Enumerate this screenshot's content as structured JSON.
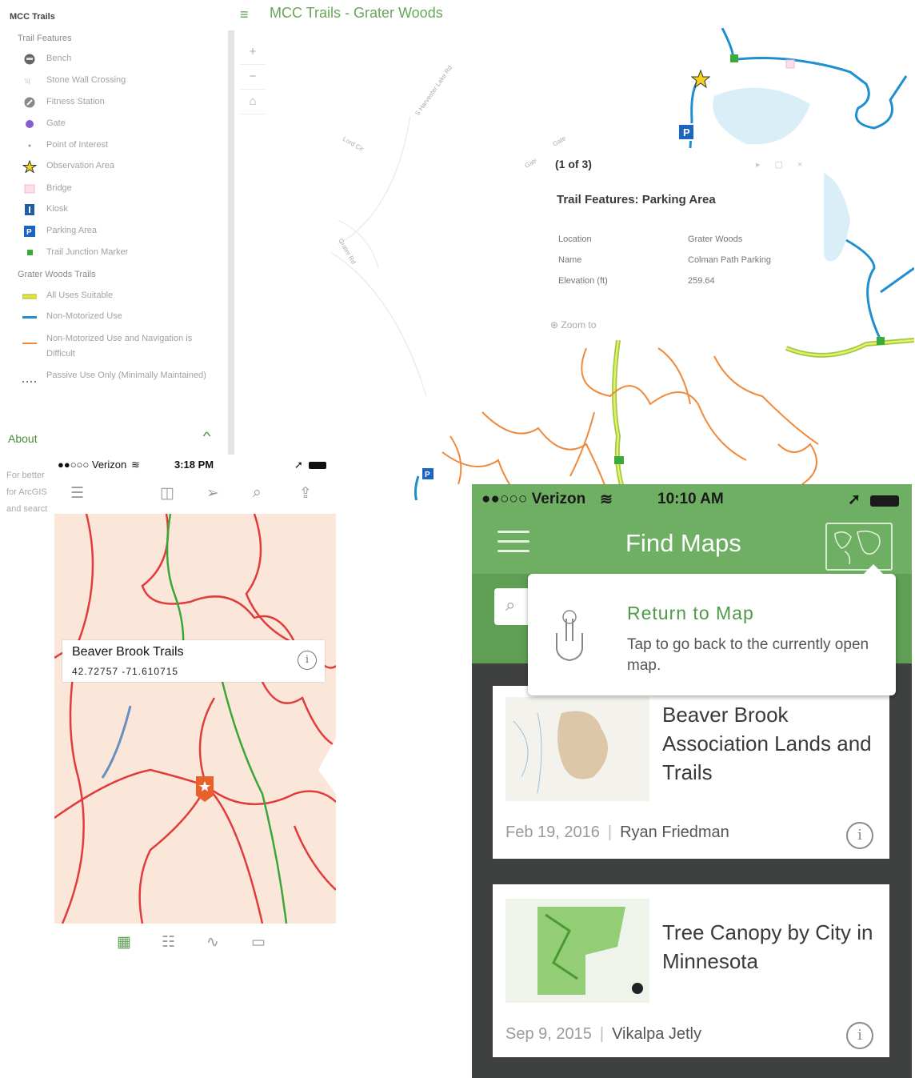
{
  "webapp": {
    "sidebar_title": "MCC Trails",
    "header_title": "MCC Trails - Grater Woods",
    "legend": {
      "trail_features_heading": "Trail Features",
      "trail_features": [
        "Bench",
        "Stone Wall Crossing",
        "Fitness Station",
        "Gate",
        "Point of Interest",
        "Observation Area",
        "Bridge",
        "Kiosk",
        "Parking Area",
        "Trail Junction Marker"
      ],
      "trails_heading": "Grater Woods Trails",
      "trails": [
        "All Uses Suitable",
        "Non-Motorized Use",
        "Non-Motorized Use and Navigation is Difficult",
        "Passive Use Only (Minimally Maintained)"
      ]
    },
    "about_label": "About",
    "about_text": "For better for ArcGIS and searct",
    "map_tools": [
      "+",
      "−",
      "⌂"
    ],
    "road_labels": [
      "S Harvester Lake Rd",
      "Lord Cir",
      "Grater Rd",
      "Gate",
      "Gate"
    ],
    "popup": {
      "count": "(1 of 3)",
      "title": "Trail Features: Parking Area",
      "fields": [
        {
          "key": "Location",
          "value": "Grater Woods"
        },
        {
          "key": "Name",
          "value": "Colman Path Parking"
        },
        {
          "key": "Elevation (ft)",
          "value": "259.64"
        }
      ],
      "zoom_label": "Zoom to"
    }
  },
  "phone_small": {
    "carrier": "●●○○○ Verizon",
    "time": "3:18 PM",
    "callout": {
      "title": "Beaver Brook Trails",
      "coords": "42.72757  -71.610715"
    }
  },
  "phone_large": {
    "carrier": "●●○○○ Verizon",
    "time": "10:10 AM",
    "title": "Find Maps",
    "tip": {
      "title": "Return to Map",
      "body": "Tap to go back to the currently open map."
    },
    "cards": [
      {
        "title": "Beaver Brook Association Lands and Trails",
        "date": "Feb 19, 2016",
        "author": "Ryan Friedman"
      },
      {
        "title": "Tree Canopy by City in Minnesota",
        "date": "Sep 9, 2015",
        "author": "Vikalpa Jetly"
      }
    ]
  },
  "colors": {
    "accent_green": "#6faf63",
    "trail_orange": "#f08a3c",
    "trail_blue": "#1f8fd0",
    "trail_red": "#e03c3c"
  }
}
